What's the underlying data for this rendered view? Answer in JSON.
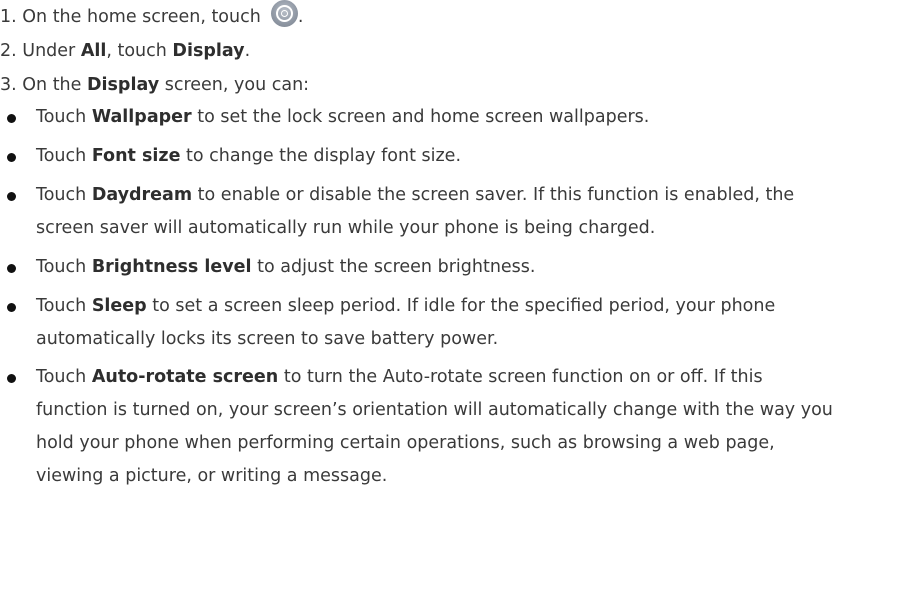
{
  "steps": [
    {
      "number": "1.",
      "before": " On the home screen, touch",
      "icon": "settings-icon",
      "after": "."
    },
    {
      "number": "2.",
      "before": " Under ",
      "bold1": "All",
      "middle": ", touch ",
      "bold2": "Display",
      "after": "."
    },
    {
      "number": "3.",
      "before": " On the ",
      "bold1": "Display",
      "after": " screen, you can:"
    }
  ],
  "bullets": [
    {
      "bold": "Wallpaper",
      "lines": [
        "to set the lock screen and home screen wallpapers."
      ]
    },
    {
      "bold": "Font size",
      "lines": [
        "to change the display font size."
      ]
    },
    {
      "bold": "Daydream",
      "lines": [
        "to enable or disable the screen saver. If this function is enabled, the",
        "screen saver will automatically run while your phone is being charged."
      ]
    },
    {
      "bold": "Brightness level",
      "lines": [
        "to adjust the screen brightness."
      ]
    },
    {
      "bold": "Sleep",
      "lines": [
        "to set a screen sleep period. If idle for the specified period, your phone",
        "automatically locks its screen to save battery power."
      ]
    },
    {
      "bold": "Auto-rotate screen",
      "lines": [
        "to turn the Auto-rotate screen function on or off. If this",
        "function is turned on, your screen’s orientation will automatically change with the way you",
        "hold your phone when performing certain operations, such as browsing a web page,",
        "viewing a picture, or writing a message."
      ]
    }
  ],
  "touch_word": "Touch"
}
